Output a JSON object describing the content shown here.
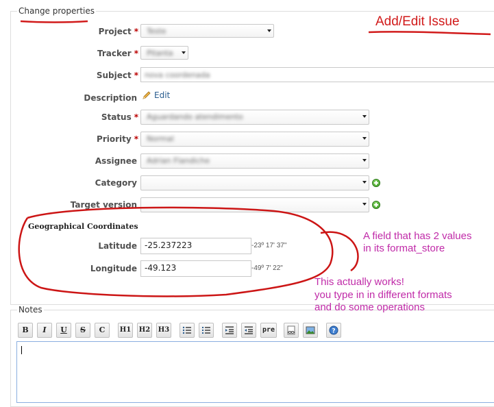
{
  "form": {
    "legend": "Change properties",
    "fields": {
      "project": {
        "label": "Project",
        "value": "Teste"
      },
      "tracker": {
        "label": "Tracker",
        "value": "Pitanta"
      },
      "subject": {
        "label": "Subject",
        "value": "nova coordenada"
      },
      "description": {
        "label": "Description",
        "edit_label": "Edit"
      },
      "status": {
        "label": "Status",
        "value": "Aguardando atendimento"
      },
      "priority": {
        "label": "Priority",
        "value": "Normal"
      },
      "assignee": {
        "label": "Assignee",
        "value": "Adrian Flandiche"
      },
      "category": {
        "label": "Category",
        "value": ""
      },
      "target_version": {
        "label": "Target version",
        "value": ""
      }
    },
    "required_marker": "*",
    "geo": {
      "title": "Geographical Coordinates",
      "latitude": {
        "label": "Latitude",
        "value": "-25.237223",
        "hint": "-23º 17' 37\""
      },
      "longitude": {
        "label": "Longitude",
        "value": "-49.123",
        "hint": "-49º 7' 22\""
      }
    }
  },
  "notes": {
    "legend": "Notes",
    "toolbar": [
      {
        "name": "bold",
        "text": "B"
      },
      {
        "name": "italic",
        "text": "I"
      },
      {
        "name": "underline",
        "text": "U"
      },
      {
        "name": "strikethrough",
        "text": "S"
      },
      {
        "name": "code",
        "text": "C"
      },
      {
        "name": "heading-1",
        "text": "H1"
      },
      {
        "name": "heading-2",
        "text": "H2"
      },
      {
        "name": "heading-3",
        "text": "H3"
      },
      {
        "name": "unordered-list",
        "text": ""
      },
      {
        "name": "ordered-list",
        "text": ""
      },
      {
        "name": "quote",
        "text": ""
      },
      {
        "name": "unquote",
        "text": ""
      },
      {
        "name": "preformatted",
        "text": "pre"
      },
      {
        "name": "wiki-link",
        "text": ""
      },
      {
        "name": "image",
        "text": ""
      },
      {
        "name": "help",
        "text": ""
      }
    ],
    "value": ""
  },
  "annotations": {
    "title": "Add/Edit Issue",
    "note1_line1": "A field that has 2 values",
    "note1_line2": "in its format_store",
    "note2_line1": "This actually works!",
    "note2_line2": "you type in in different formats",
    "note2_line3": "and do some operations"
  },
  "colors": {
    "annotation_red": "#d11a1a",
    "annotation_purple": "#c02aa8",
    "required": "#bb0000"
  }
}
